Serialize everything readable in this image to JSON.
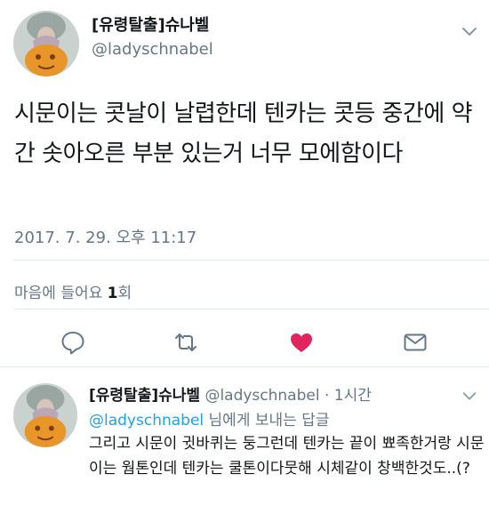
{
  "tweet": {
    "display_name": "[유령탈출]슈나벨",
    "handle": "@ladyschnabel",
    "text": "시문이는 콧날이 날렵한데 텐카는 콧등 중간에 약간 솟아오른 부분 있는거 너무 모에함이다",
    "timestamp": "2017. 7. 29. 오후 11:17",
    "likes_label": "마음에 들어요",
    "likes_count": "1",
    "likes_unit": "회",
    "liked": true,
    "like_color": "#e0245e"
  },
  "reply": {
    "display_name": "[유령탈출]슈나벨",
    "handle_time": "@ladyschnabel · 1시간",
    "mention": "@ladyschnabel",
    "reply_suffix": " 님에게 보내는 답글",
    "text": "그리고 시문이 귓바퀴는 둥그런데 텐카는 끝이 뾰족한거랑 시문이는 웜톤인데 텐카는 쿨톤이다뭇해 시체같이 창백한것도..(?"
  },
  "icons": {
    "reply": "reply-icon",
    "retweet": "retweet-icon",
    "like": "heart-icon",
    "dm": "mail-icon",
    "more": "chevron-down-icon"
  },
  "colors": {
    "text": "#14171a",
    "secondary": "#657786",
    "link": "#1da1f2",
    "divider": "#e1e8ed"
  }
}
